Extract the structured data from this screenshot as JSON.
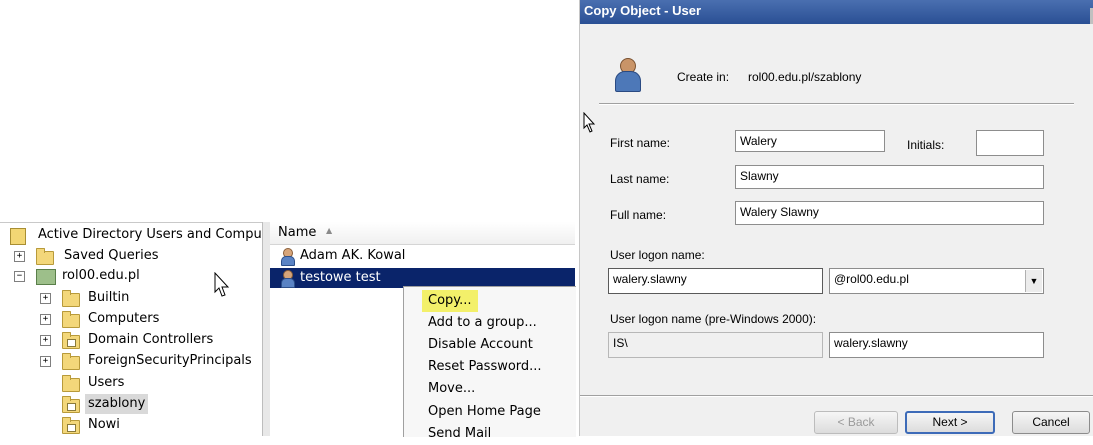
{
  "tree": {
    "root_label": "Active Directory Users and Comput",
    "items": [
      {
        "label": "Saved Queries",
        "expander": "+"
      },
      {
        "label": "rol00.edu.pl",
        "expander": "−"
      },
      {
        "label": "Builtin",
        "expander": "+"
      },
      {
        "label": "Computers",
        "expander": "+"
      },
      {
        "label": "Domain Controllers",
        "expander": "+"
      },
      {
        "label": "ForeignSecurityPrincipals",
        "expander": "+"
      },
      {
        "label": "Users",
        "expander": ""
      },
      {
        "label": "szablony",
        "expander": ""
      },
      {
        "label": "Nowi",
        "expander": ""
      }
    ]
  },
  "list": {
    "column_name": "Name",
    "sort_indicator": "▲",
    "rows": [
      {
        "name": "Adam AK. Kowal"
      },
      {
        "name": "testowe test"
      }
    ]
  },
  "context_menu": {
    "items": [
      "Copy...",
      "Add to a group...",
      "Disable Account",
      "Reset Password...",
      "Move...",
      "Open Home Page",
      "Send Mail"
    ]
  },
  "dialog": {
    "title": "Copy Object - User",
    "create_in_label": "Create in:",
    "create_in_value": "rol00.edu.pl/szablony",
    "first_name_label": "First name:",
    "first_name_value": "Walery",
    "initials_label": "Initials:",
    "initials_value": "",
    "last_name_label": "Last name:",
    "last_name_value": "Slawny",
    "full_name_label": "Full name:",
    "full_name_value": "Walery Slawny",
    "logon_label": "User logon name:",
    "logon_value": "walery.slawny",
    "domain_value": "@rol00.edu.pl",
    "pre2000_label": "User logon name (pre-Windows 2000):",
    "pre2000_domain": "IS\\",
    "pre2000_value": "walery.slawny",
    "back_label": "< Back",
    "next_label": "Next >",
    "cancel_label": "Cancel"
  },
  "icons": {
    "collapse_arrow": "▼",
    "sort_up": "▲"
  }
}
